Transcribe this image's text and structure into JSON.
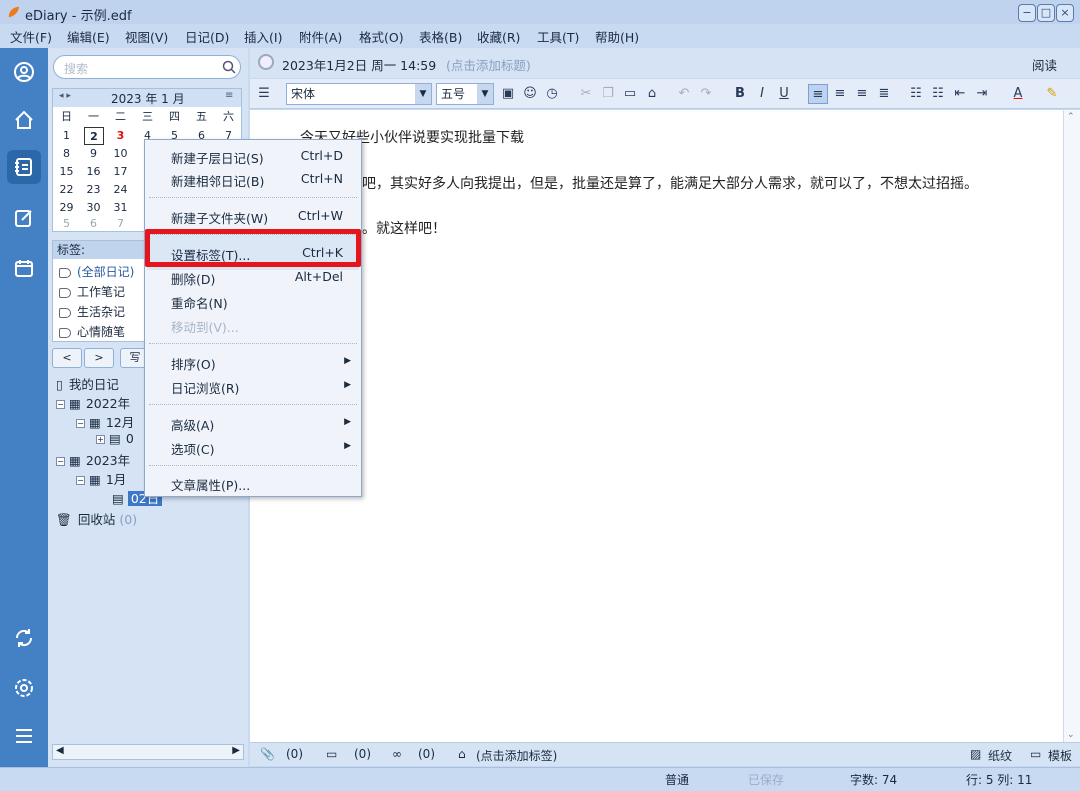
{
  "window": {
    "title": "eDiary - 示例.edf",
    "controls": [
      "−",
      "□",
      "×"
    ]
  },
  "menubar": [
    "文件(F)",
    "编辑(E)",
    "视图(V)",
    "日记(D)",
    "插入(I)",
    "附件(A)",
    "格式(O)",
    "表格(B)",
    "收藏(R)",
    "工具(T)",
    "帮助(H)"
  ],
  "sidebar": {
    "search_placeholder": "搜索",
    "calendar": {
      "month_label": "2023 年 1 月",
      "weekdays": [
        "日",
        "一",
        "二",
        "三",
        "四",
        "五",
        "六"
      ],
      "rows": [
        [
          "1",
          "2",
          "3",
          "4",
          "5",
          "6",
          "7"
        ],
        [
          "8",
          "9",
          "10",
          "",
          "",
          "",
          ""
        ],
        [
          "15",
          "16",
          "17",
          "",
          "",
          "",
          ""
        ],
        [
          "22",
          "23",
          "24",
          "",
          "",
          "",
          ""
        ],
        [
          "29",
          "30",
          "31",
          "",
          "",
          "",
          ""
        ],
        [
          "5",
          "6",
          "7",
          "",
          "",
          "",
          ""
        ]
      ]
    },
    "tags_header": "标签:",
    "tags": [
      "(全部日记)",
      "工作笔记",
      "生活杂记",
      "心情随笔"
    ],
    "nav": {
      "prev": "<",
      "next": ">",
      "write": "写"
    },
    "tree": {
      "root": "我的日记",
      "y2022": "2022年",
      "m12": "12月",
      "d0": "0",
      "y2023": "2023年",
      "m1": "1月",
      "d02": "02日",
      "recycle": "回收站",
      "recycle_count": "(0)"
    }
  },
  "editor": {
    "date_title": "2023年1月2日 周一 14:59",
    "title_placeholder": "(点击添加标题)",
    "read_mode": "阅读",
    "font": "宋体",
    "size": "五号",
    "lines": [
      "今天又好些小伙伴说要实现批量下载",
      "吧，其实好多人向我提出，但是，批量还是算了，能满足大部分人需求，就可以了，不想太过招摇。",
      "。就这样吧！"
    ]
  },
  "context_menu": {
    "items": [
      {
        "label": "新建子层日记(S)",
        "shortcut": "Ctrl+D"
      },
      {
        "label": "新建相邻日记(B)",
        "shortcut": "Ctrl+N"
      },
      {
        "label": "新建子文件夹(W)",
        "shortcut": "Ctrl+W"
      },
      {
        "label": "设置标签(T)...",
        "shortcut": "Ctrl+K"
      },
      {
        "label": "删除(D)",
        "shortcut": "Alt+Del"
      },
      {
        "label": "重命名(N)",
        "shortcut": ""
      },
      {
        "label": "移动到(V)...",
        "shortcut": ""
      },
      {
        "label": "排序(O)",
        "shortcut": ""
      },
      {
        "label": "日记浏览(R)",
        "shortcut": ""
      },
      {
        "label": "高级(A)",
        "shortcut": ""
      },
      {
        "label": "选项(C)",
        "shortcut": ""
      },
      {
        "label": "文章属性(P)...",
        "shortcut": ""
      }
    ],
    "highlighted": "设置标签(T)..."
  },
  "bottom": {
    "attach_count": "(0)",
    "comment_count": "(0)",
    "link_count": "(0)",
    "add_tag": "(点击添加标签)",
    "paper": "纸纹",
    "template": "模板"
  },
  "status": {
    "mode": "普通",
    "saved": "已保存",
    "wordcount": "字数: 74",
    "position": "行: 5  列: 11"
  },
  "colors": {
    "accent": "#4380c4",
    "highlight": "#e8141c"
  }
}
